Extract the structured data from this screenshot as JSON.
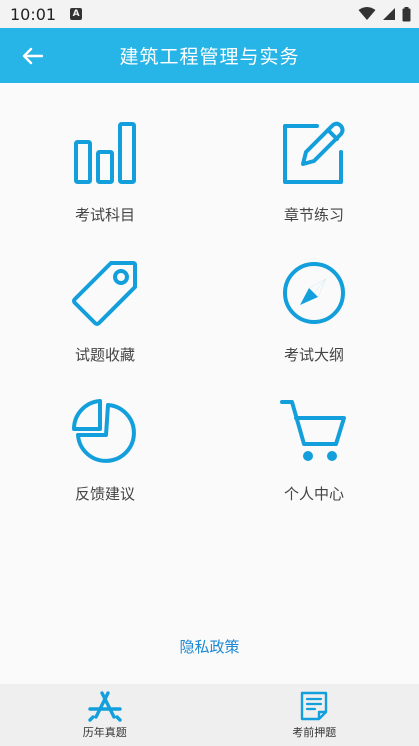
{
  "status_bar": {
    "time": "10:01",
    "notification_icon": "A"
  },
  "app_bar": {
    "title": "建筑工程管理与实务",
    "back_icon": "arrow-left-icon"
  },
  "menu": [
    {
      "label": "考试科目",
      "icon": "bar-chart-icon"
    },
    {
      "label": "章节练习",
      "icon": "edit-icon"
    },
    {
      "label": "试题收藏",
      "icon": "tag-icon"
    },
    {
      "label": "考试大纲",
      "icon": "compass-icon"
    },
    {
      "label": "反馈建议",
      "icon": "pie-chart-icon"
    },
    {
      "label": "个人中心",
      "icon": "cart-icon"
    }
  ],
  "privacy_link": "隐私政策",
  "bottom_nav": [
    {
      "label": "历年真题",
      "icon": "app-store-icon"
    },
    {
      "label": "考前押题",
      "icon": "document-icon"
    }
  ],
  "colors": {
    "primary": "#27b4e6",
    "icon": "#139fdc",
    "link": "#1e88d2"
  }
}
